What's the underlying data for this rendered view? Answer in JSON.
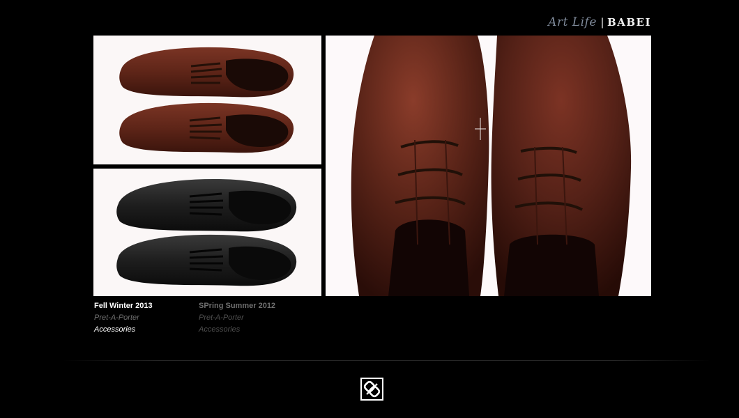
{
  "brand": {
    "art_life": "Art Life",
    "separator": "|",
    "name": "BABEI"
  },
  "collections": [
    {
      "title": "Fell Winter 2013",
      "items": [
        "Pret-A-Porter",
        "Accessories"
      ]
    },
    {
      "title": "SPring Summer 2012",
      "items": [
        "Pret-A-Porter",
        "Accessories"
      ]
    }
  ],
  "colors": {
    "background": "#000000",
    "leather_brown": "#5a2418",
    "leather_black": "#1b1b1b",
    "active_text": "#ffffff",
    "inactive_text": "#6f6f6f"
  }
}
